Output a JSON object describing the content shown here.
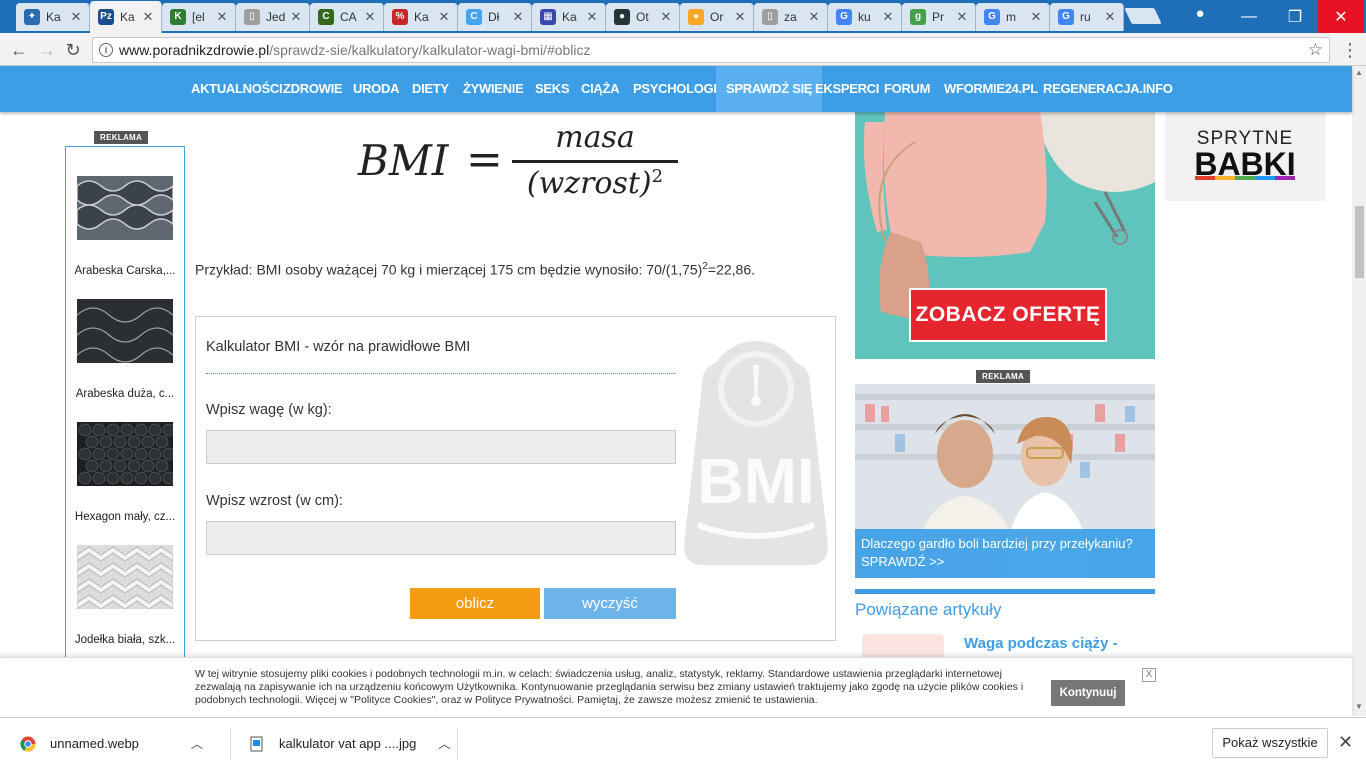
{
  "browser": {
    "tabs": [
      {
        "label": "Ka",
        "color": "#2b6cb0",
        "letter": "✦"
      },
      {
        "label": "Ka",
        "color": "#1a4f8c",
        "letter": "Pz",
        "active": true
      },
      {
        "label": "[el",
        "color": "#2e7d32",
        "letter": "K"
      },
      {
        "label": "Jed",
        "color": "#9e9e9e",
        "letter": "▯"
      },
      {
        "label": "CA",
        "color": "#33691e",
        "letter": "C"
      },
      {
        "label": "Ka",
        "color": "#c62828",
        "letter": "%"
      },
      {
        "label": "Dł",
        "color": "#42a5f5",
        "letter": "C"
      },
      {
        "label": "Ka",
        "color": "#3949ab",
        "letter": "▦"
      },
      {
        "label": "Ot",
        "color": "#263238",
        "letter": "●"
      },
      {
        "label": "Or",
        "color": "#f9a825",
        "letter": "●"
      },
      {
        "label": "za",
        "color": "#9e9e9e",
        "letter": "▯"
      },
      {
        "label": "ku",
        "color": "#4285f4",
        "letter": "G"
      },
      {
        "label": "Pr",
        "color": "#43a047",
        "letter": "g"
      },
      {
        "label": "m",
        "color": "#4285f4",
        "letter": "G"
      },
      {
        "label": "ru",
        "color": "#4285f4",
        "letter": "G"
      }
    ],
    "url_domain": "www.poradnikzdrowie.pl",
    "url_path": "/sprawdz-sie/kalkulatory/kalkulator-wagi-bmi/#oblicz",
    "window_controls": {
      "minimize": "—",
      "restore": "❐",
      "close": "✕"
    }
  },
  "nav": {
    "items": [
      "AKTUALNOŚCI",
      "ZDROWIE",
      "URODA",
      "DIETY",
      "ŻYWIENIE",
      "SEKS",
      "CIĄŻA",
      "PSYCHOLOGIA",
      "SPRAWDŹ SIĘ",
      "EKSPERCI",
      "FORUM",
      "WFORMIE24.PL",
      "REGENERACJA.INFO"
    ],
    "active": "SPRAWDŹ SIĘ"
  },
  "ads": {
    "reklama_label": "REKLAMA",
    "products": [
      {
        "name": "Arabeska Carska,..."
      },
      {
        "name": "Arabeska duża, c..."
      },
      {
        "name": "Hexagon mały, cz..."
      },
      {
        "name": "Jodełka biała, szk..."
      }
    ],
    "sweater_cta": "ZOBACZ OFERTĘ",
    "babki_line1": "SPRYTNE",
    "babki_line2": "BABKI",
    "pharm_caption": "Dlaczego gardło boli bardziej przy przełykaniu? SPRAWDŹ >>"
  },
  "formula": {
    "lhs": "BMI",
    "eq": "=",
    "numerator": "masa",
    "denominator": "(wzrost)",
    "exponent": "2"
  },
  "example": {
    "text": "Przykład: BMI osoby ważącej 70 kg i mierzącej 175 cm będzie wynosiło: 70/(1,75)",
    "sup": "2",
    "result": "=22,86."
  },
  "calculator": {
    "title": "Kalkulator BMI - wzór na prawidłowe BMI",
    "weight_label": "Wpisz wagę (w kg):",
    "weight_value": "",
    "height_label": "Wpisz wzrost (w cm):",
    "height_value": "",
    "calc_button": "oblicz",
    "clear_button": "wyczyść",
    "graphic_text": "BMI"
  },
  "related": {
    "heading": "Powiązane artykuły",
    "first_item": "Waga podczas ciąży -"
  },
  "cookie": {
    "text": "W tej witrynie stosujemy pliki cookies i podobnych technologii m.in. w celach: świadczenia usług, analiz, statystyk, reklamy. Standardowe ustawienia przeglądarki internetowej zezwalają na zapisywanie ich na urządzeniu końcowym Użytkownika. Kontynuowanie przeglądania serwisu bez zmiany ustawień traktujemy jako zgodę na użycie plików cookies i podobnych technologii. Więcej w \"Polityce Cookies\", oraz w Polityce Prywatności. Pamiętaj, że zawsze możesz zmienić te ustawienia.",
    "button": "Kontynuuj",
    "close": "X"
  },
  "downloads": {
    "items": [
      {
        "name": "unnamed.webp"
      },
      {
        "name": "kalkulator vat app ....jpg"
      }
    ],
    "show_all": "Pokaż wszystkie",
    "close": "✕"
  }
}
